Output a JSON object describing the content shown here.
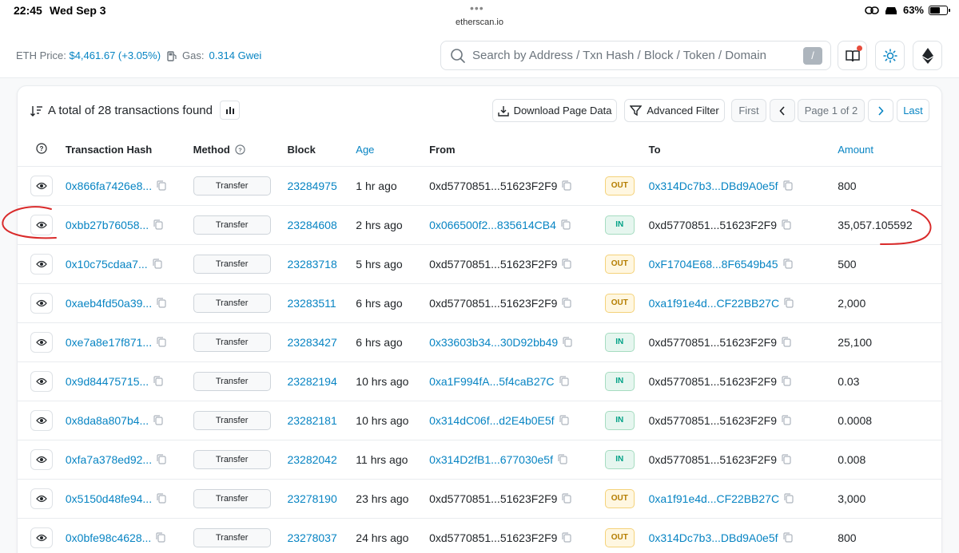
{
  "status_bar": {
    "time": "22:45",
    "date": "Wed Sep 3",
    "url": "etherscan.io",
    "battery": "63%",
    "battery_level": 0.63
  },
  "header": {
    "eth_price_label": "ETH Price:",
    "eth_price_value": "$4,461.67 (+3.05%)",
    "gas_label": "Gas:",
    "gas_value": "0.314 Gwei",
    "search_placeholder": "Search by Address / Txn Hash / Block / Token / Domain Name",
    "search_shortcut": "/"
  },
  "card": {
    "total_text": "A total of 28 transactions found",
    "download_label": "Download Page Data",
    "filter_label": "Advanced Filter",
    "first_label": "First",
    "page_label": "Page 1 of 2",
    "last_label": "Last"
  },
  "columns": {
    "hash": "Transaction Hash",
    "method": "Method",
    "block": "Block",
    "age": "Age",
    "from": "From",
    "to": "To",
    "amount": "Amount"
  },
  "rows": [
    {
      "hash": "0x866fa7426e8...",
      "method": "Transfer",
      "block": "23284975",
      "age": "1 hr ago",
      "from": "0xd5770851...51623F2F9",
      "from_link": false,
      "dir": "OUT",
      "to": "0x314Dc7b3...DBd9A0e5f",
      "to_link": true,
      "amount": "800"
    },
    {
      "hash": "0xbb27b76058...",
      "method": "Transfer",
      "block": "23284608",
      "age": "2 hrs ago",
      "from": "0x066500f2...835614CB4",
      "from_link": true,
      "dir": "IN",
      "to": "0xd5770851...51623F2F9",
      "to_link": false,
      "amount": "35,057.105592"
    },
    {
      "hash": "0x10c75cdaa7...",
      "method": "Transfer",
      "block": "23283718",
      "age": "5 hrs ago",
      "from": "0xd5770851...51623F2F9",
      "from_link": false,
      "dir": "OUT",
      "to": "0xF1704E68...8F6549b45",
      "to_link": true,
      "amount": "500"
    },
    {
      "hash": "0xaeb4fd50a39...",
      "method": "Transfer",
      "block": "23283511",
      "age": "6 hrs ago",
      "from": "0xd5770851...51623F2F9",
      "from_link": false,
      "dir": "OUT",
      "to": "0xa1f91e4d...CF22BB27C",
      "to_link": true,
      "amount": "2,000"
    },
    {
      "hash": "0xe7a8e17f871...",
      "method": "Transfer",
      "block": "23283427",
      "age": "6 hrs ago",
      "from": "0x33603b34...30D92bb49",
      "from_link": true,
      "dir": "IN",
      "to": "0xd5770851...51623F2F9",
      "to_link": false,
      "amount": "25,100"
    },
    {
      "hash": "0x9d84475715...",
      "method": "Transfer",
      "block": "23282194",
      "age": "10 hrs ago",
      "from": "0xa1F994fA...5f4caB27C",
      "from_link": true,
      "dir": "IN",
      "to": "0xd5770851...51623F2F9",
      "to_link": false,
      "amount": "0.03"
    },
    {
      "hash": "0x8da8a807b4...",
      "method": "Transfer",
      "block": "23282181",
      "age": "10 hrs ago",
      "from": "0x314dC06f...d2E4b0E5f",
      "from_link": true,
      "dir": "IN",
      "to": "0xd5770851...51623F2F9",
      "to_link": false,
      "amount": "0.0008"
    },
    {
      "hash": "0xfa7a378ed92...",
      "method": "Transfer",
      "block": "23282042",
      "age": "11 hrs ago",
      "from": "0x314D2fB1...677030e5f",
      "from_link": true,
      "dir": "IN",
      "to": "0xd5770851...51623F2F9",
      "to_link": false,
      "amount": "0.008"
    },
    {
      "hash": "0x5150d48fe94...",
      "method": "Transfer",
      "block": "23278190",
      "age": "23 hrs ago",
      "from": "0xd5770851...51623F2F9",
      "from_link": false,
      "dir": "OUT",
      "to": "0xa1f91e4d...CF22BB27C",
      "to_link": true,
      "amount": "3,000"
    },
    {
      "hash": "0x0bfe98c4628...",
      "method": "Transfer",
      "block": "23278037",
      "age": "24 hrs ago",
      "from": "0xd5770851...51623F2F9",
      "from_link": false,
      "dir": "OUT",
      "to": "0x314Dc7b3...DBd9A0e5f",
      "to_link": true,
      "amount": "800"
    }
  ]
}
